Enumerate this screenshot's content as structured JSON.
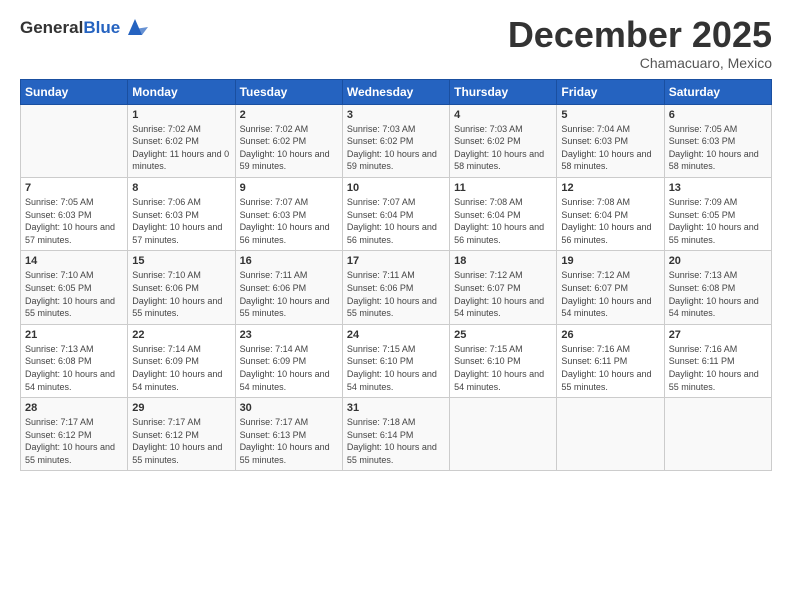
{
  "logo": {
    "general": "General",
    "blue": "Blue"
  },
  "header": {
    "month": "December 2025",
    "location": "Chamacuaro, Mexico"
  },
  "weekdays": [
    "Sunday",
    "Monday",
    "Tuesday",
    "Wednesday",
    "Thursday",
    "Friday",
    "Saturday"
  ],
  "weeks": [
    [
      {
        "day": "",
        "info": ""
      },
      {
        "day": "1",
        "info": "Sunrise: 7:02 AM\nSunset: 6:02 PM\nDaylight: 11 hours\nand 0 minutes."
      },
      {
        "day": "2",
        "info": "Sunrise: 7:02 AM\nSunset: 6:02 PM\nDaylight: 10 hours\nand 59 minutes."
      },
      {
        "day": "3",
        "info": "Sunrise: 7:03 AM\nSunset: 6:02 PM\nDaylight: 10 hours\nand 59 minutes."
      },
      {
        "day": "4",
        "info": "Sunrise: 7:03 AM\nSunset: 6:02 PM\nDaylight: 10 hours\nand 58 minutes."
      },
      {
        "day": "5",
        "info": "Sunrise: 7:04 AM\nSunset: 6:03 PM\nDaylight: 10 hours\nand 58 minutes."
      },
      {
        "day": "6",
        "info": "Sunrise: 7:05 AM\nSunset: 6:03 PM\nDaylight: 10 hours\nand 58 minutes."
      }
    ],
    [
      {
        "day": "7",
        "info": "Sunrise: 7:05 AM\nSunset: 6:03 PM\nDaylight: 10 hours\nand 57 minutes."
      },
      {
        "day": "8",
        "info": "Sunrise: 7:06 AM\nSunset: 6:03 PM\nDaylight: 10 hours\nand 57 minutes."
      },
      {
        "day": "9",
        "info": "Sunrise: 7:07 AM\nSunset: 6:03 PM\nDaylight: 10 hours\nand 56 minutes."
      },
      {
        "day": "10",
        "info": "Sunrise: 7:07 AM\nSunset: 6:04 PM\nDaylight: 10 hours\nand 56 minutes."
      },
      {
        "day": "11",
        "info": "Sunrise: 7:08 AM\nSunset: 6:04 PM\nDaylight: 10 hours\nand 56 minutes."
      },
      {
        "day": "12",
        "info": "Sunrise: 7:08 AM\nSunset: 6:04 PM\nDaylight: 10 hours\nand 56 minutes."
      },
      {
        "day": "13",
        "info": "Sunrise: 7:09 AM\nSunset: 6:05 PM\nDaylight: 10 hours\nand 55 minutes."
      }
    ],
    [
      {
        "day": "14",
        "info": "Sunrise: 7:10 AM\nSunset: 6:05 PM\nDaylight: 10 hours\nand 55 minutes."
      },
      {
        "day": "15",
        "info": "Sunrise: 7:10 AM\nSunset: 6:06 PM\nDaylight: 10 hours\nand 55 minutes."
      },
      {
        "day": "16",
        "info": "Sunrise: 7:11 AM\nSunset: 6:06 PM\nDaylight: 10 hours\nand 55 minutes."
      },
      {
        "day": "17",
        "info": "Sunrise: 7:11 AM\nSunset: 6:06 PM\nDaylight: 10 hours\nand 55 minutes."
      },
      {
        "day": "18",
        "info": "Sunrise: 7:12 AM\nSunset: 6:07 PM\nDaylight: 10 hours\nand 54 minutes."
      },
      {
        "day": "19",
        "info": "Sunrise: 7:12 AM\nSunset: 6:07 PM\nDaylight: 10 hours\nand 54 minutes."
      },
      {
        "day": "20",
        "info": "Sunrise: 7:13 AM\nSunset: 6:08 PM\nDaylight: 10 hours\nand 54 minutes."
      }
    ],
    [
      {
        "day": "21",
        "info": "Sunrise: 7:13 AM\nSunset: 6:08 PM\nDaylight: 10 hours\nand 54 minutes."
      },
      {
        "day": "22",
        "info": "Sunrise: 7:14 AM\nSunset: 6:09 PM\nDaylight: 10 hours\nand 54 minutes."
      },
      {
        "day": "23",
        "info": "Sunrise: 7:14 AM\nSunset: 6:09 PM\nDaylight: 10 hours\nand 54 minutes."
      },
      {
        "day": "24",
        "info": "Sunrise: 7:15 AM\nSunset: 6:10 PM\nDaylight: 10 hours\nand 54 minutes."
      },
      {
        "day": "25",
        "info": "Sunrise: 7:15 AM\nSunset: 6:10 PM\nDaylight: 10 hours\nand 54 minutes."
      },
      {
        "day": "26",
        "info": "Sunrise: 7:16 AM\nSunset: 6:11 PM\nDaylight: 10 hours\nand 55 minutes."
      },
      {
        "day": "27",
        "info": "Sunrise: 7:16 AM\nSunset: 6:11 PM\nDaylight: 10 hours\nand 55 minutes."
      }
    ],
    [
      {
        "day": "28",
        "info": "Sunrise: 7:17 AM\nSunset: 6:12 PM\nDaylight: 10 hours\nand 55 minutes."
      },
      {
        "day": "29",
        "info": "Sunrise: 7:17 AM\nSunset: 6:12 PM\nDaylight: 10 hours\nand 55 minutes."
      },
      {
        "day": "30",
        "info": "Sunrise: 7:17 AM\nSunset: 6:13 PM\nDaylight: 10 hours\nand 55 minutes."
      },
      {
        "day": "31",
        "info": "Sunrise: 7:18 AM\nSunset: 6:14 PM\nDaylight: 10 hours\nand 55 minutes."
      },
      {
        "day": "",
        "info": ""
      },
      {
        "day": "",
        "info": ""
      },
      {
        "day": "",
        "info": ""
      }
    ]
  ]
}
